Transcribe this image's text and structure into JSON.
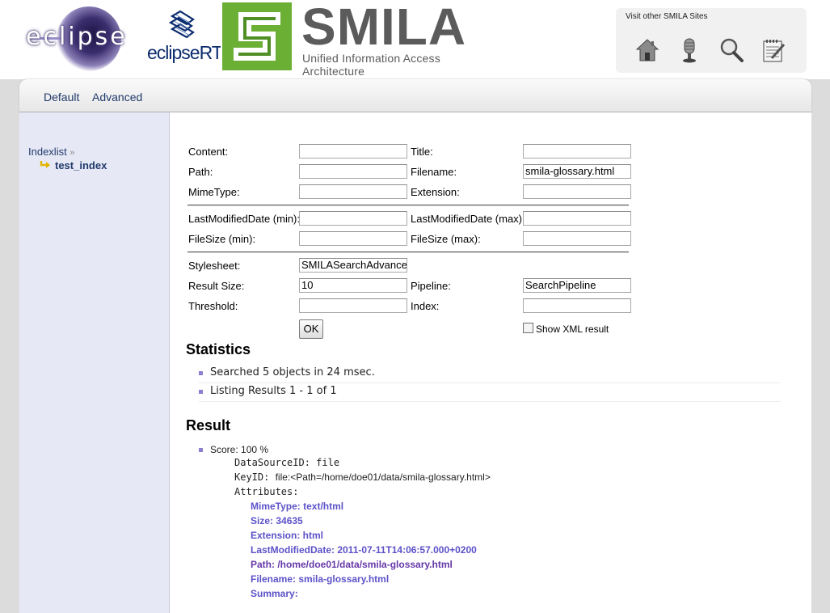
{
  "header": {
    "eclipse_logo_text": "eclipse",
    "eclipsert_logo_text": "eclipseRT",
    "smila_logo_title": "SMILA",
    "smila_logo_subtitle": "Unified Information Access Architecture",
    "sites_label": "Visit other SMILA Sites",
    "site_icons": [
      "home-icon",
      "microphone-icon",
      "magnifier-icon",
      "notepad-icon"
    ]
  },
  "nav": {
    "default_label": "Default",
    "advanced_label": "Advanced"
  },
  "sidebar": {
    "indexlist_label": "Indexlist",
    "indexlist_marker": "»",
    "index_item": "test_index"
  },
  "form": {
    "content_label": "Content:",
    "content_value": "",
    "title_label": "Title:",
    "title_value": "",
    "path_label": "Path:",
    "path_value": "",
    "filename_label": "Filename:",
    "filename_value": "smila-glossary.html",
    "mimetype_label": "MimeType:",
    "mimetype_value": "",
    "extension_label": "Extension:",
    "extension_value": "",
    "lmd_min_label": "LastModifiedDate (min):",
    "lmd_min_value": "",
    "lmd_max_label": "LastModifiedDate (max):",
    "lmd_max_value": "",
    "fs_min_label": "FileSize (min):",
    "fs_min_value": "",
    "fs_max_label": "FileSize (max):",
    "fs_max_value": "",
    "stylesheet_label": "Stylesheet:",
    "stylesheet_value": "SMILASearchAdvanced",
    "result_size_label": "Result Size:",
    "result_size_value": "10",
    "pipeline_label": "Pipeline:",
    "pipeline_value": "SearchPipeline",
    "threshold_label": "Threshold:",
    "threshold_value": "",
    "index_label": "Index:",
    "index_value": "",
    "ok_label": "OK",
    "show_xml_label": "Show XML result",
    "show_xml_checked": false
  },
  "statistics": {
    "heading": "Statistics",
    "items": [
      "Searched 5 objects in 24 msec.",
      "Listing Results 1 - 1 of 1"
    ]
  },
  "result": {
    "heading": "Result",
    "score": "Score: 100 %",
    "datasource_key": "DataSourceID:",
    "datasource_value": "file",
    "keyid_key": "KeyID:",
    "keyid_value": "file:<Path=/home/doe01/data/smila-glossary.html>",
    "attributes_key": "Attributes:",
    "attributes": [
      "MimeType: text/html",
      "Size: 34635",
      "Extension: html",
      "LastModifiedDate: 2011-07-11T14:06:57.000+0200",
      "Path: /home/doe01/data/smila-glossary.html",
      "Filename: smila-glossary.html",
      "Summary:"
    ]
  }
}
